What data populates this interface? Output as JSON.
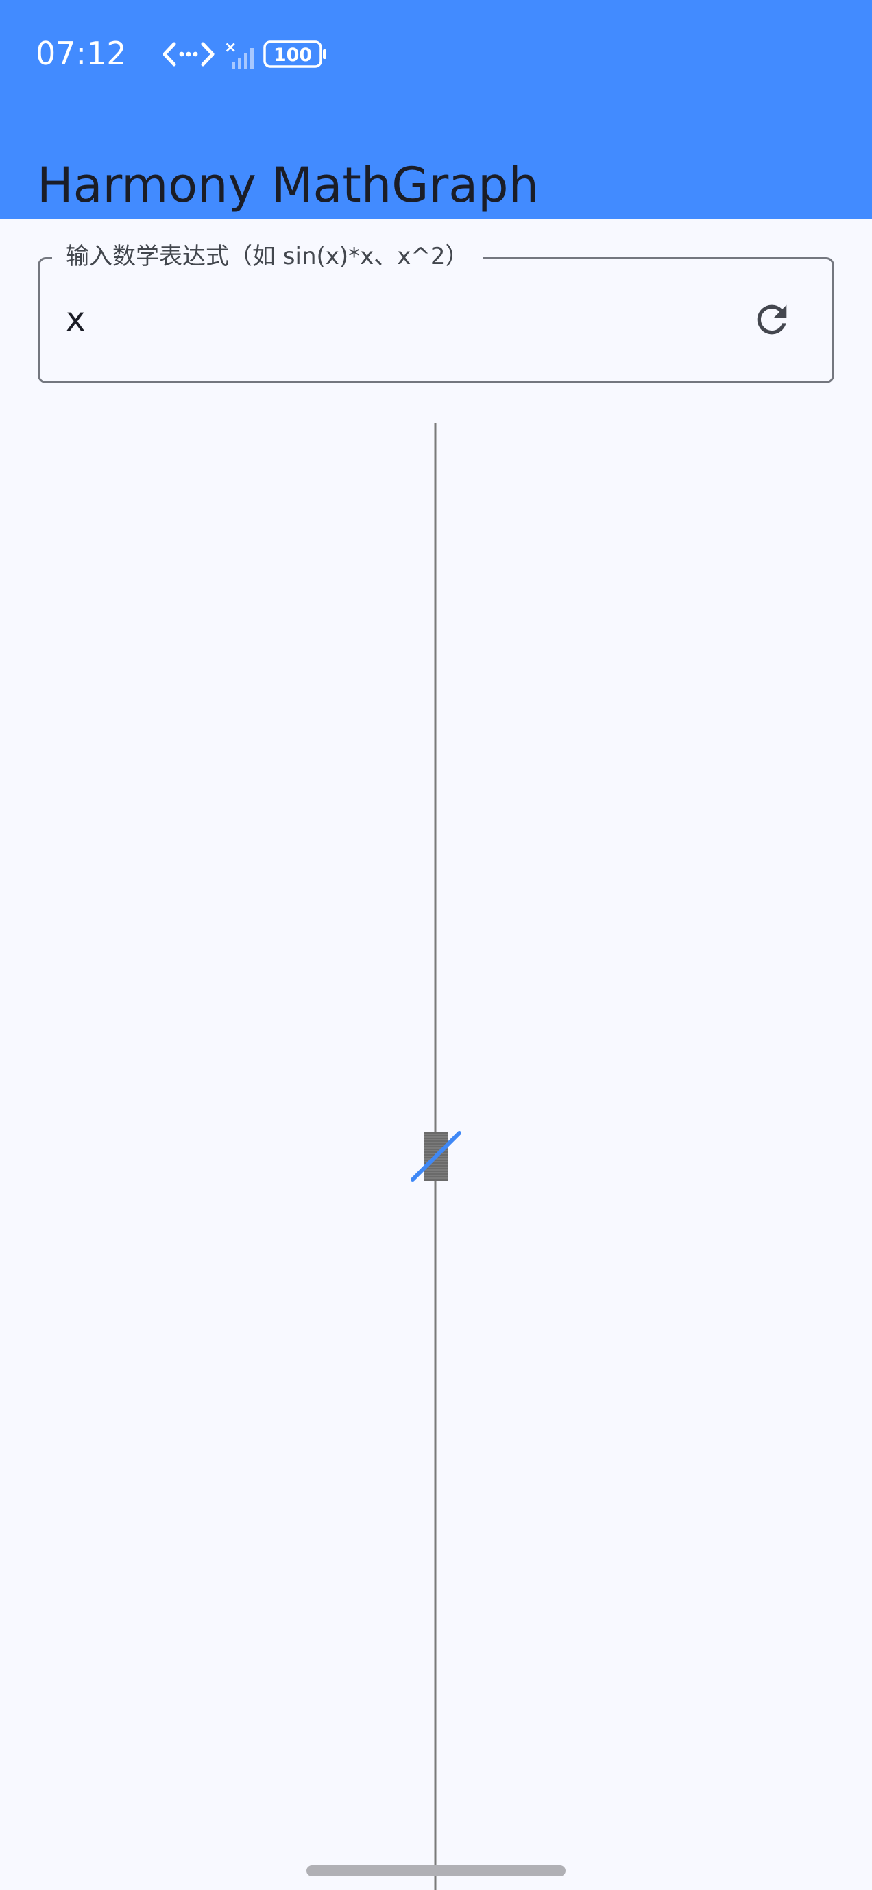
{
  "status_bar": {
    "time": "07:12",
    "battery": "100"
  },
  "app_bar": {
    "title": "Harmony MathGraph"
  },
  "expression_input": {
    "label": "输入数学表达式（如 sin(x)*x、x^2）",
    "value": "x"
  },
  "icons": {
    "reset": "refresh-icon",
    "network": "data-transfer-icon",
    "signal": "cellular-signal-icon",
    "battery": "battery-icon"
  },
  "colors": {
    "app_bar": "#428bff",
    "background": "#f8f9ff",
    "axis": "#7a7a7a",
    "curve": "#3f88f6"
  }
}
